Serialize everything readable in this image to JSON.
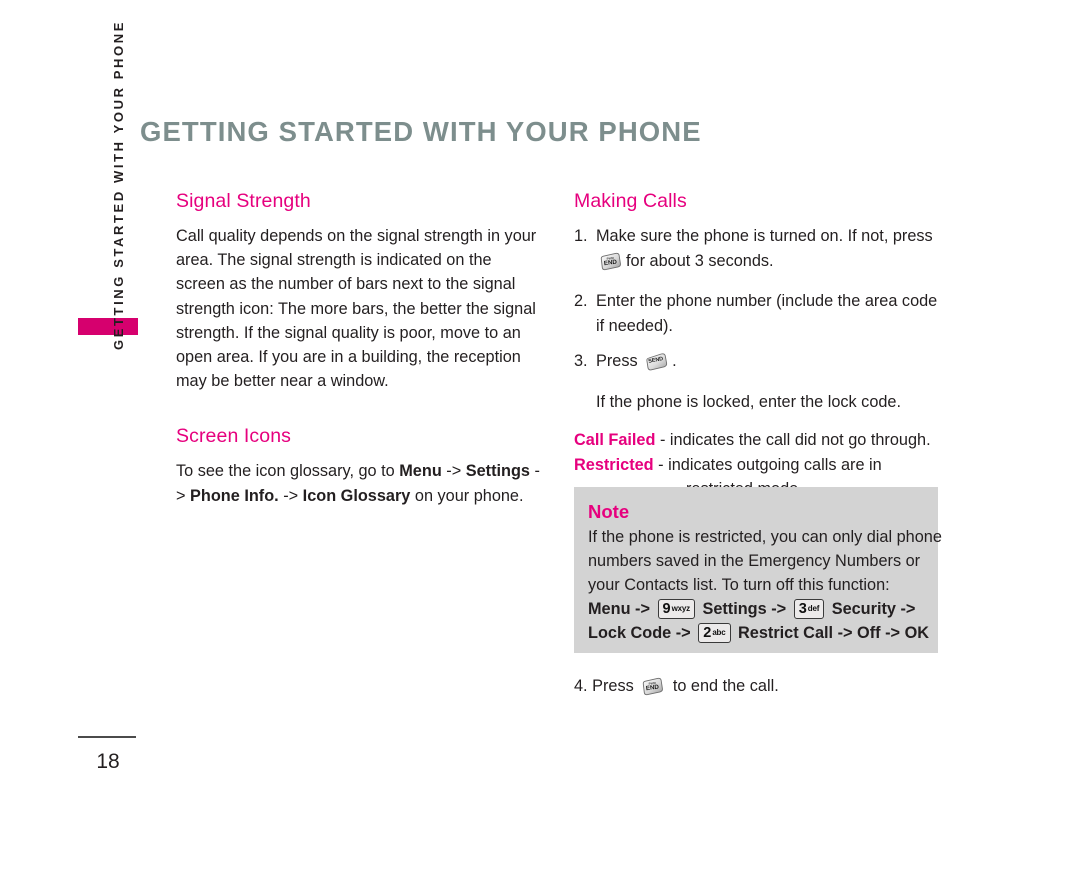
{
  "page": {
    "title": "GETTING STARTED WITH YOUR PHONE",
    "side_rail_text": "GETTING STARTED WITH YOUR PHONE",
    "page_number": "18",
    "accent_color": "#e6007e",
    "tab_color": "#d6006e",
    "title_color": "#7d8e8d",
    "note_background": "#d3d3d3"
  },
  "left_column": {
    "signal_strength": {
      "heading": "Signal Strength",
      "body": "Call quality depends on the signal strength in your area. The signal strength is indicated on the screen as the number of bars next to the signal strength icon: The more bars, the better the signal strength. If the signal quality is poor, move to an open area. If you are in a building, the reception may be better near a window."
    },
    "screen_icons": {
      "heading": "Screen Icons",
      "body_parts": {
        "p1": "To see the icon glossary, go to ",
        "b1": "Menu",
        "p2": " -> ",
        "b2": "Settings",
        "p3": " -> ",
        "b3": "Phone Info.",
        "p4": " -> ",
        "b4": "Icon Glossary",
        "p5": " on your phone."
      }
    }
  },
  "right_column": {
    "heading": "Making Calls",
    "steps": [
      {
        "num": "1.",
        "text_before": "Make sure the phone is turned on. If not, press",
        "icon": "end-key-icon",
        "icon_label": "END",
        "text_after": "for about 3 seconds."
      },
      {
        "num": "2.",
        "text_before": "Enter the phone number (include the area code if needed).",
        "icon": "",
        "icon_label": "",
        "text_after": ""
      },
      {
        "num": "3.",
        "text_before": "Press",
        "icon": "send-key-icon",
        "icon_label": "SEND",
        "text_after": "."
      }
    ],
    "locked_note": "If the phone is locked, enter the lock code.",
    "definitions": [
      {
        "term": "Call Failed",
        "dash": "-",
        "desc": "indicates the call did not go through.",
        "cont": ""
      },
      {
        "term": "Restricted",
        "dash": "-",
        "desc": "indicates outgoing calls are in",
        "cont": "restricted mode."
      }
    ],
    "final_step": {
      "num": "4.",
      "text_before": "Press",
      "icon": "end-key-icon",
      "icon_label": "END",
      "text_after": "to end the call."
    }
  },
  "note_box": {
    "title": "Note",
    "lines": [
      "If the phone is restricted, you can only dial phone",
      "numbers saved in the Emergency Numbers or",
      "your Contacts list. To turn off this function:"
    ],
    "path_line_1": {
      "t1": "Menu",
      "a1": "->",
      "key1_digit": "9",
      "key1_letters": "wxyz",
      "t2": "Settings",
      "a2": "->",
      "key2_digit": "3",
      "key2_letters": "def",
      "t3": "Security",
      "a3": "->"
    },
    "path_line_2": {
      "t1": "Lock Code",
      "a1": "->",
      "key1_digit": "2",
      "key1_letters": "abc",
      "t2": "Restrict Call",
      "a2": "->",
      "t3": "Off",
      "a3": "->",
      "t4": "OK"
    }
  }
}
